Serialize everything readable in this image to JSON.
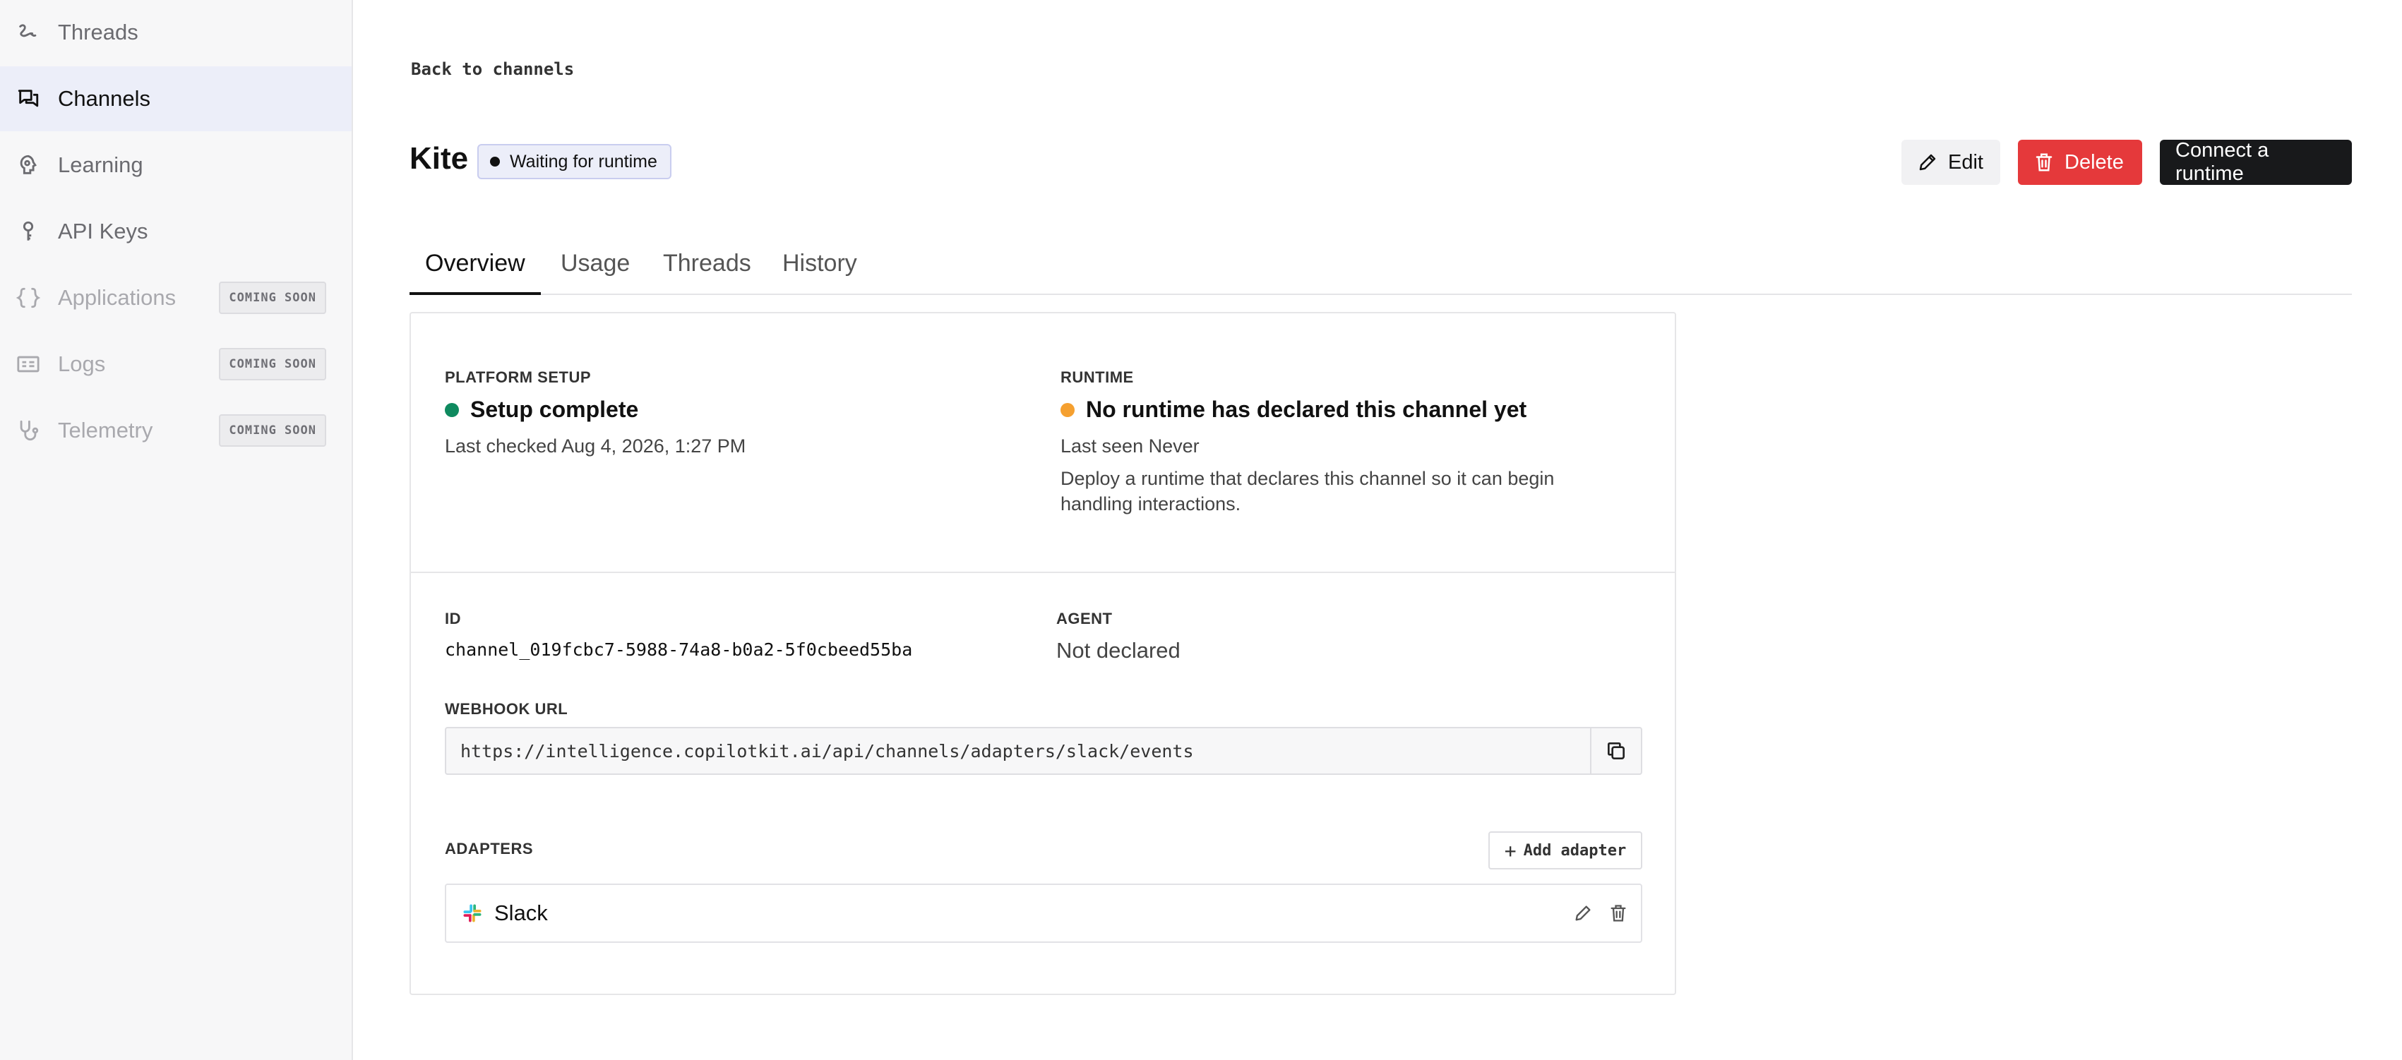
{
  "sidebar": {
    "items": [
      {
        "label": "Threads",
        "icon": "threads-icon",
        "active": false,
        "coming_soon": ""
      },
      {
        "label": "Channels",
        "icon": "chat-bubbles-icon",
        "active": true,
        "coming_soon": ""
      },
      {
        "label": "Learning",
        "icon": "brain-icon",
        "active": false,
        "coming_soon": ""
      },
      {
        "label": "API Keys",
        "icon": "key-icon",
        "active": false,
        "coming_soon": ""
      },
      {
        "label": "Applications",
        "icon": "braces-icon",
        "active": false,
        "coming_soon": "COMING SOON"
      },
      {
        "label": "Logs",
        "icon": "log-icon",
        "active": false,
        "coming_soon": "COMING SOON"
      },
      {
        "label": "Telemetry",
        "icon": "stethoscope-icon",
        "active": false,
        "coming_soon": "COMING SOON"
      }
    ]
  },
  "header": {
    "back_label": "Back to channels",
    "title": "Kite",
    "status": "Waiting for runtime",
    "edit_label": "Edit",
    "delete_label": "Delete",
    "connect_label": "Connect a runtime"
  },
  "tabs": [
    {
      "label": "Overview",
      "active": true
    },
    {
      "label": "Usage",
      "active": false
    },
    {
      "label": "Threads",
      "active": false
    },
    {
      "label": "History",
      "active": false
    }
  ],
  "overview": {
    "platform_setup": {
      "label": "PLATFORM SETUP",
      "status": "Setup complete",
      "status_color": "#0f8a5f",
      "detail": "Last checked Aug 4, 2026, 1:27 PM"
    },
    "runtime": {
      "label": "RUNTIME",
      "status": "No runtime has declared this channel yet",
      "status_color": "#f5a030",
      "last_seen": "Last seen Never",
      "hint": "Deploy a runtime that declares this channel so it can begin handling interactions."
    },
    "id": {
      "label": "ID",
      "value": "channel_019fcbc7-5988-74a8-b0a2-5f0cbeed55ba"
    },
    "agent": {
      "label": "AGENT",
      "value": "Not declared"
    },
    "webhook": {
      "label": "WEBHOOK URL",
      "value": "https://intelligence.copilotkit.ai/api/channels/adapters/slack/events"
    },
    "adapters": {
      "label": "ADAPTERS",
      "add_label": "Add adapter",
      "items": [
        {
          "name": "Slack",
          "icon": "slack-icon"
        }
      ]
    }
  },
  "colors": {
    "accent_bg": "#eceef9",
    "delete": "#e5393b",
    "primary": "#18191b"
  }
}
